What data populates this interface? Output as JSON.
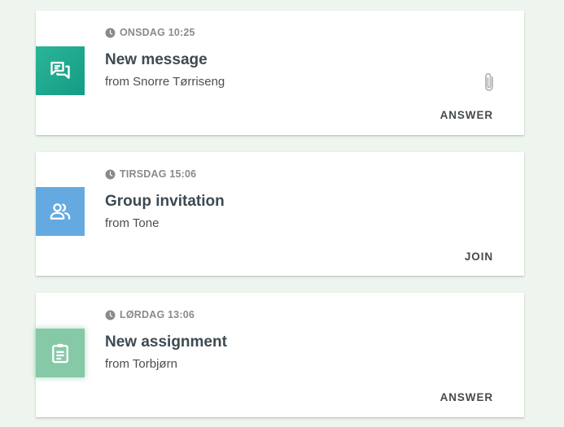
{
  "cards": [
    {
      "timestamp": "ONSDAG 10:25",
      "title": "New message",
      "sender": "from Snorre Tørriseng",
      "action": "ANSWER",
      "icon": "chat-icon",
      "has_attachment": true,
      "tile_color": "#1ea68c"
    },
    {
      "timestamp": "TIRSDAG 15:06",
      "title": "Group invitation",
      "sender": "from Tone",
      "action": "JOIN",
      "icon": "group-icon",
      "has_attachment": false,
      "tile_color": "#64aae0"
    },
    {
      "timestamp": "LØRDAG 13:06",
      "title": "New assignment",
      "sender": "from Torbjørn",
      "action": "ANSWER",
      "icon": "assignment-icon",
      "has_attachment": false,
      "tile_color": "#85c9a6"
    }
  ],
  "colors": {
    "background": "#eef5ee",
    "card": "#ffffff",
    "title_text": "#3e4a52",
    "meta_text": "#8a8a8a"
  }
}
